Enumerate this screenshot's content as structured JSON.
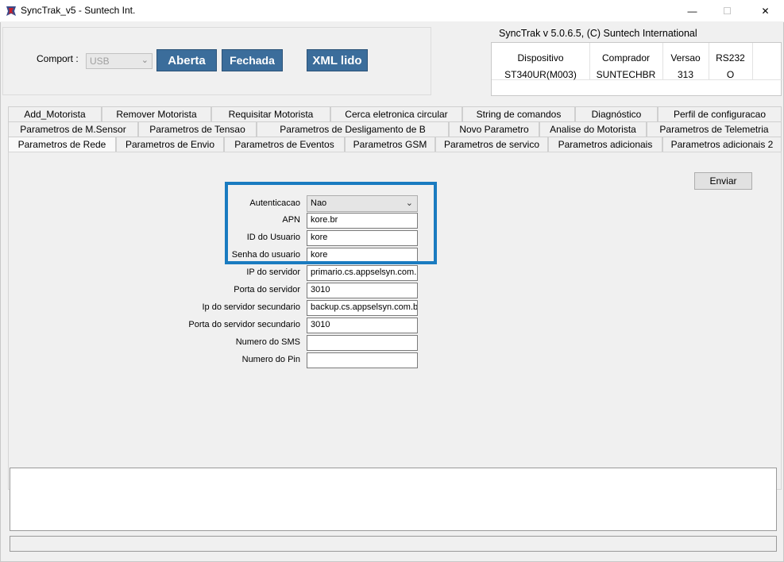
{
  "window": {
    "title": "SyncTrak_v5 - Suntech Int.",
    "minimize": "—",
    "maximize": "☐",
    "close": "✕"
  },
  "comport": {
    "label": "Comport :",
    "value": "USB",
    "open_button": "Aberta",
    "close_button": "Fechada",
    "xml_button": "XML lido"
  },
  "version": "SyncTrak v 5.0.6.5, (C) Suntech International",
  "device_info": {
    "headers": [
      "Dispositivo",
      "Comprador",
      "Versao",
      "RS232"
    ],
    "values": [
      "ST340UR(M003)",
      "SUNTECHBR",
      "313",
      "O"
    ]
  },
  "tabs": {
    "row1": [
      "Add_Motorista",
      "Remover Motorista",
      "Requisitar Motorista",
      "Cerca eletronica circular",
      "String de comandos",
      "Diagnóstico",
      "Perfil de configuracao"
    ],
    "row2": [
      "Parametros  de M.Sensor",
      "Parametros de Tensao",
      "Parametros de Desligamento de B",
      "Novo Parametro",
      "Analise do Motorista",
      "Parametros de Telemetria"
    ],
    "row3": [
      "Parametros de Rede",
      "Parametros de Envio",
      "Parametros de Eventos",
      "Parametros GSM",
      "Parametros de servico",
      "Parametros adicionais",
      "Parametros adicionais 2"
    ],
    "active": "Parametros de Rede"
  },
  "send_button": "Enviar",
  "form": {
    "autenticacao": {
      "label": "Autenticacao",
      "value": "Nao"
    },
    "apn": {
      "label": "APN",
      "value": "kore.br"
    },
    "user_id": {
      "label": "ID do Usuario",
      "value": "kore"
    },
    "password": {
      "label": "Senha do usuario",
      "value": "kore"
    },
    "server_ip": {
      "label": "IP do servidor",
      "value": "primario.cs.appselsyn.com."
    },
    "server_port": {
      "label": "Porta do servidor",
      "value": "3010"
    },
    "server_ip2": {
      "label": "Ip do servidor secundario",
      "value": "backup.cs.appselsyn.com.b"
    },
    "server_port2": {
      "label": "Porta do servidor secundario",
      "value": "3010"
    },
    "sms_number": {
      "label": "Numero do SMS",
      "value": ""
    },
    "pin_number": {
      "label": "Numero do Pin",
      "value": ""
    }
  },
  "colors": {
    "accent_button": "#3b6d9b",
    "highlight": "#1a7bc0"
  }
}
